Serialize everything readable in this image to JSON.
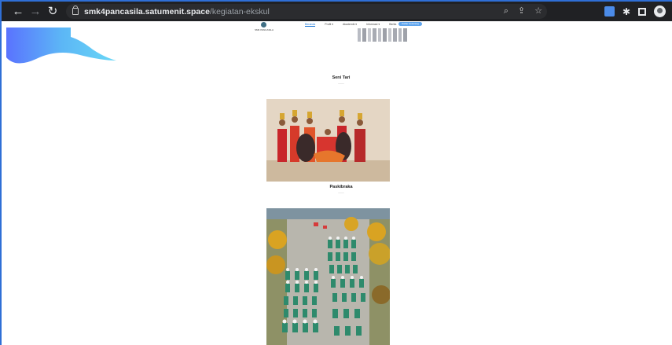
{
  "browser": {
    "url_host": "smk4pancasila.satumenit.space",
    "url_path": "/kegiatan-ekskul",
    "icons": [
      "back-arrow-icon",
      "forward-arrow-icon",
      "reload-icon",
      "lock-icon",
      "zoom-icon",
      "share-icon",
      "star-icon",
      "extension-icon",
      "puzzle-icon",
      "side-panel-icon",
      "profile-avatar-icon"
    ]
  },
  "site": {
    "logo_text": "SMK PANCASILA",
    "menu": [
      {
        "label": "Beranda",
        "active": true
      },
      {
        "label": "Profil ▾",
        "active": false
      },
      {
        "label": "Akademik ▾",
        "active": false
      },
      {
        "label": "Informasi ▾",
        "active": false
      },
      {
        "label": "Berita",
        "active": false
      }
    ],
    "cta_label": "Daftar Sekarang"
  },
  "sections": [
    {
      "title": "Seni Tari",
      "subtitle": "———"
    },
    {
      "title": "Paskibraka",
      "subtitle": "———"
    }
  ],
  "colors": {
    "chrome_bg": "#202124",
    "accent": "#1e78d6",
    "wave_light": "#4fc3f7",
    "wave_dark": "#3d5afe"
  }
}
